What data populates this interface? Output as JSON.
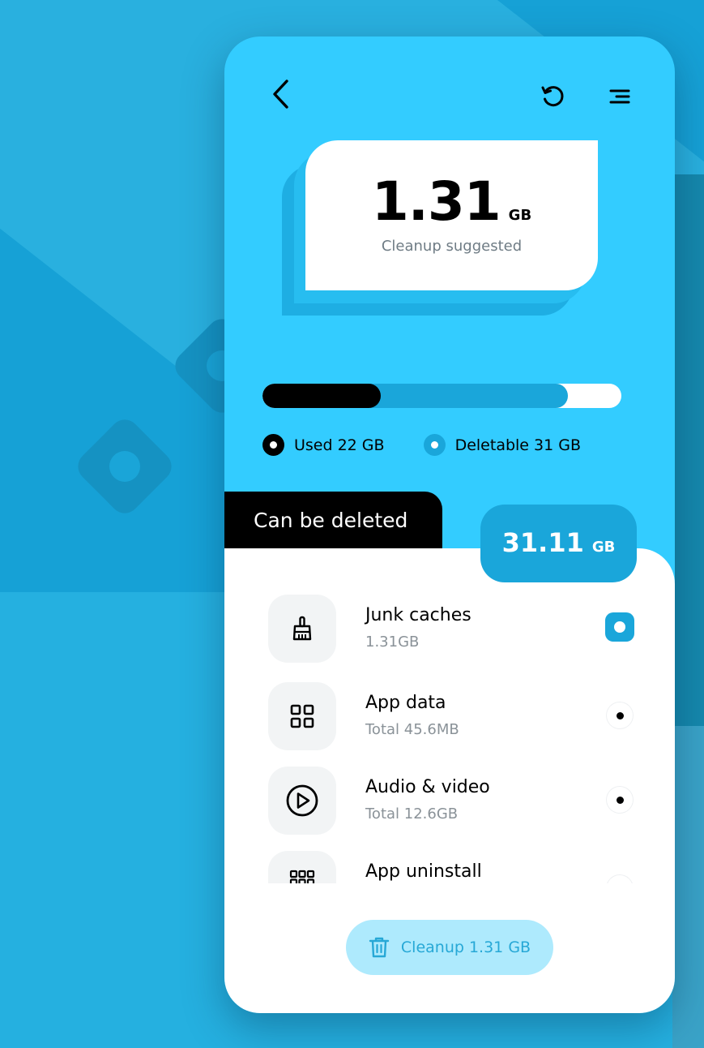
{
  "header": {
    "back_icon": "chevron-left-icon",
    "refresh_icon": "refresh-icon",
    "menu_icon": "menu-icon"
  },
  "summary": {
    "value": "1.31",
    "unit": "GB",
    "label": "Cleanup suggested"
  },
  "storage": {
    "used_fraction": 0.33,
    "deletable_fraction": 0.85,
    "legend_used": "Used 22 GB",
    "legend_deletable": "Deletable 31 GB"
  },
  "section": {
    "title": "Can be deleted",
    "total_value": "31.11",
    "total_unit": "GB"
  },
  "items": [
    {
      "name": "Junk caches",
      "size": "1.31GB",
      "icon": "broom-icon",
      "checked": true
    },
    {
      "name": "App data",
      "size": "Total 45.6MB",
      "icon": "grid-icon",
      "checked": false
    },
    {
      "name": "Audio & video",
      "size": "Total 12.6GB",
      "icon": "play-icon",
      "checked": false
    },
    {
      "name": "App uninstall",
      "size": "",
      "icon": "apps-icon",
      "checked": false
    }
  ],
  "cleanup_button": {
    "label": "Cleanup 1.31 GB",
    "icon": "trash-icon"
  },
  "colors": {
    "primary": "#33ccff",
    "accent": "#1aa6da",
    "dark": "#000000"
  }
}
